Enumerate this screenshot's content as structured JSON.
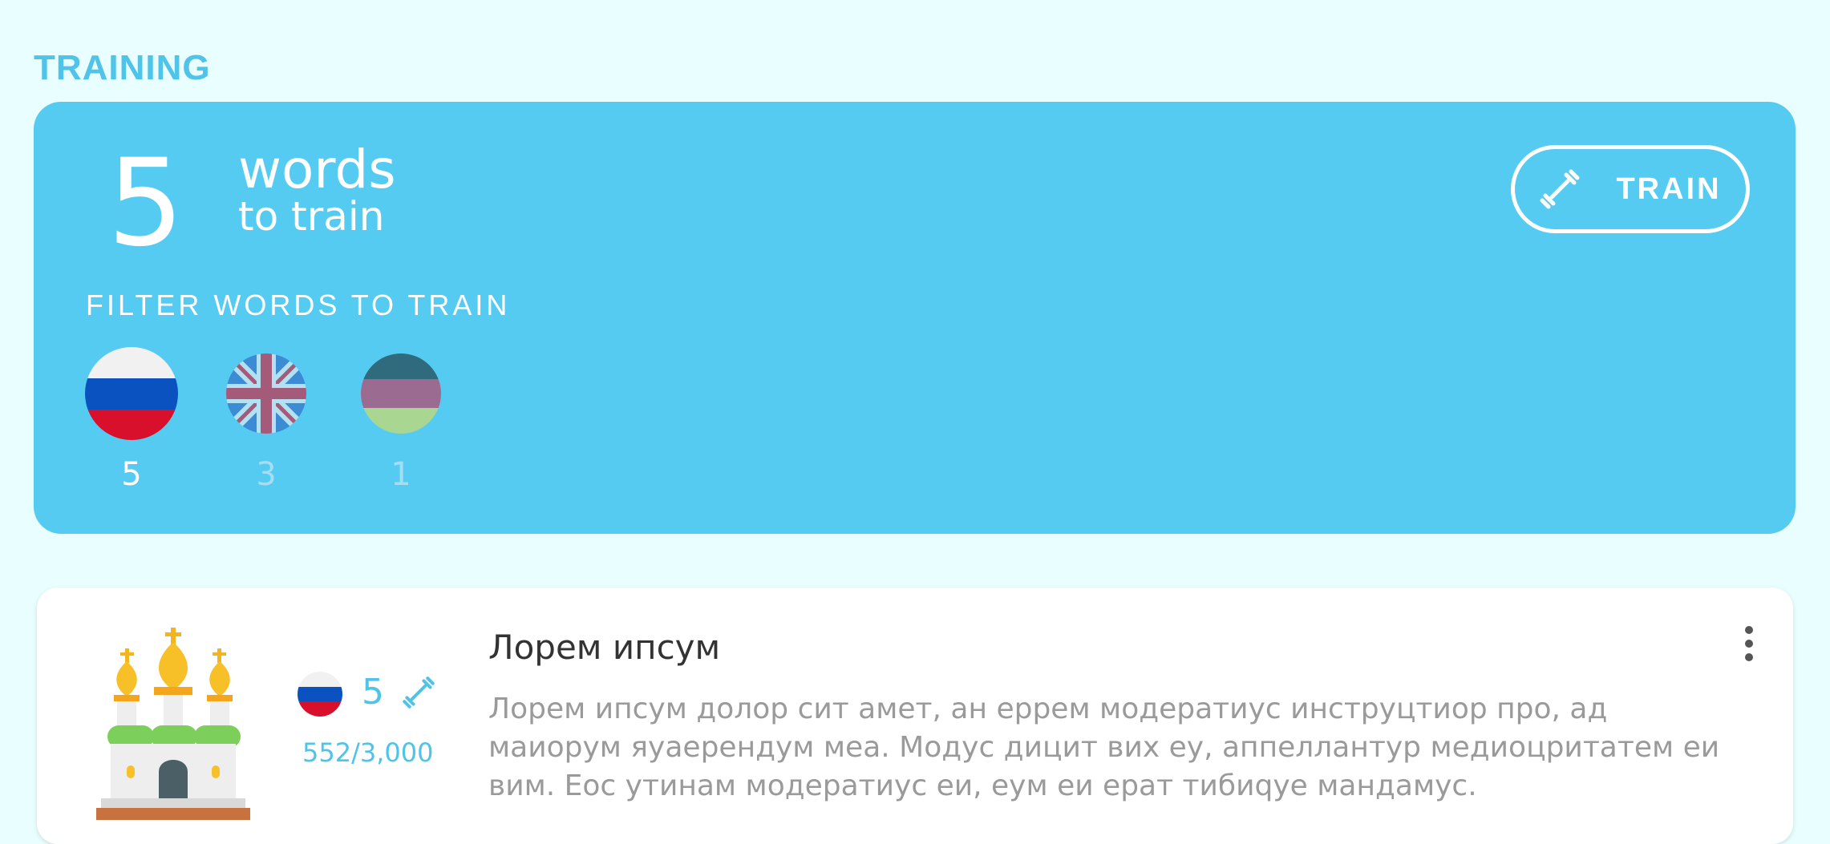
{
  "section": {
    "title": "TRAINING"
  },
  "training": {
    "count": "5",
    "words_label": "words",
    "to_train_label": "to train",
    "train_button_label": "TRAIN",
    "filter_label": "FILTER WORDS TO TRAIN",
    "flags": [
      {
        "icon": "russia-flag-icon",
        "count": "5",
        "selected": true
      },
      {
        "icon": "uk-flag-icon",
        "count": "3",
        "selected": false
      },
      {
        "icon": "tricolor-flag-icon",
        "count": "1",
        "selected": false
      }
    ]
  },
  "course": {
    "title": "Лорем ипсум",
    "description": "Лорем ипсум долор сит амет, ан еррем модератиус инструцтиор про, ад маиорум яуаерендум меа. Модус дицит вих еу, аппеллантур медиоцритатем еи вим. Еос утинам модератиус еи, еум еи ерат тибиqуе мандамус.",
    "flag_icon": "russia-flag-icon",
    "word_count": "5",
    "progress": "552/3,000",
    "image_icon": "cathedral-icon"
  },
  "colors": {
    "accent": "#56cbf1",
    "title": "#4fc3e8",
    "background": "#e9fefe"
  }
}
